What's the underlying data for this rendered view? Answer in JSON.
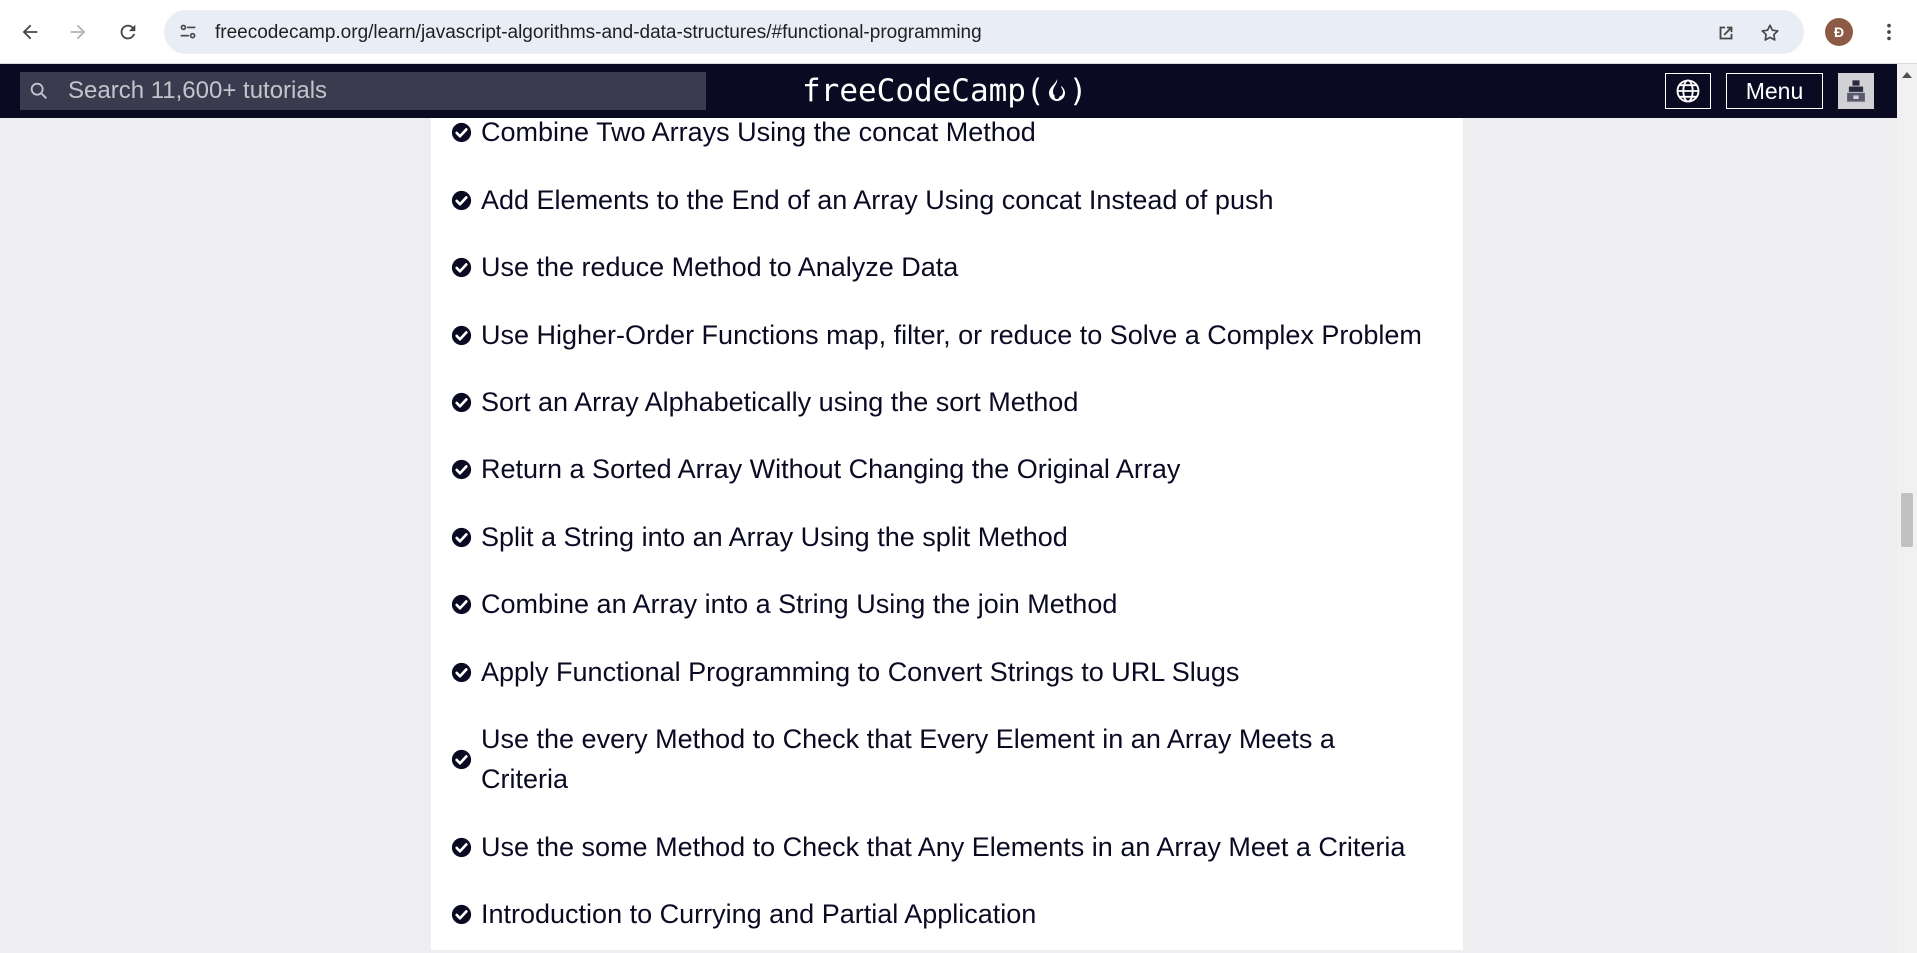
{
  "browser": {
    "url": "freecodecamp.org/learn/javascript-algorithms-and-data-structures/#functional-programming",
    "profile_initial": "Đ"
  },
  "navbar": {
    "search_placeholder": "Search 11,600+ tutorials",
    "logo_left": "freeCodeCamp(",
    "logo_right": ")",
    "menu_label": "Menu"
  },
  "challenges": [
    {
      "title": "Combine Two Arrays Using the concat Method",
      "completed": true
    },
    {
      "title": "Add Elements to the End of an Array Using concat Instead of push",
      "completed": true
    },
    {
      "title": "Use the reduce Method to Analyze Data",
      "completed": true
    },
    {
      "title": "Use Higher-Order Functions map, filter, or reduce to Solve a Complex Problem",
      "completed": true
    },
    {
      "title": "Sort an Array Alphabetically using the sort Method",
      "completed": true
    },
    {
      "title": "Return a Sorted Array Without Changing the Original Array",
      "completed": true
    },
    {
      "title": "Split a String into an Array Using the split Method",
      "completed": true
    },
    {
      "title": "Combine an Array into a String Using the join Method",
      "completed": true
    },
    {
      "title": "Apply Functional Programming to Convert Strings to URL Slugs",
      "completed": true
    },
    {
      "title": "Use the every Method to Check that Every Element in an Array Meets a Criteria",
      "completed": true
    },
    {
      "title": "Use the some Method to Check that Any Elements in an Array Meet a Criteria",
      "completed": true
    },
    {
      "title": "Introduction to Currying and Partial Application",
      "completed": true
    }
  ],
  "colors": {
    "navbar_bg": "#0a0a23",
    "page_bg": "#eeeef0",
    "card_bg": "#ffffff",
    "text": "#0a0a23"
  }
}
